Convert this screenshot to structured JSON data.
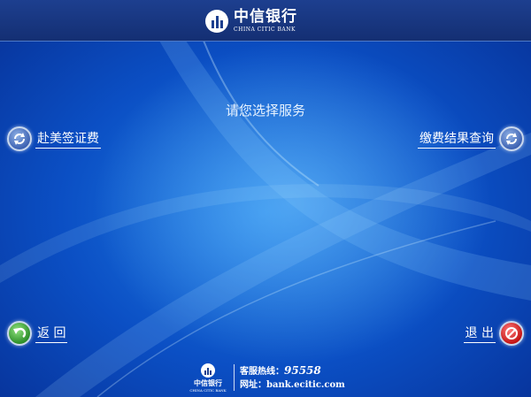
{
  "header": {
    "logo_cn": "中信银行",
    "logo_en": "CHINA CITIC BANK"
  },
  "main": {
    "prompt": "请您选择服务"
  },
  "actions": {
    "visa_fee_label": "赴美签证费",
    "result_query_label": "缴费结果查询",
    "return_label": "返 回",
    "exit_label": "退 出"
  },
  "footer": {
    "logo_cn": "中信银行",
    "logo_en": "CHINA CITIC BANK",
    "hotline_label": "客服热线：",
    "hotline_number": "95558",
    "website_label": "网址：",
    "website": "bank.ecitic.com"
  },
  "colors": {
    "background": "#0b4fc4",
    "header_bar": "#1a3a86",
    "text": "#ffffff",
    "return_accent": "#2e8f2a",
    "exit_accent": "#c41414"
  },
  "icons": {
    "visa_fee": "refresh-circle-icon",
    "result_query": "refresh-circle-icon",
    "return": "back-arrow-icon",
    "exit": "no-entry-icon"
  }
}
